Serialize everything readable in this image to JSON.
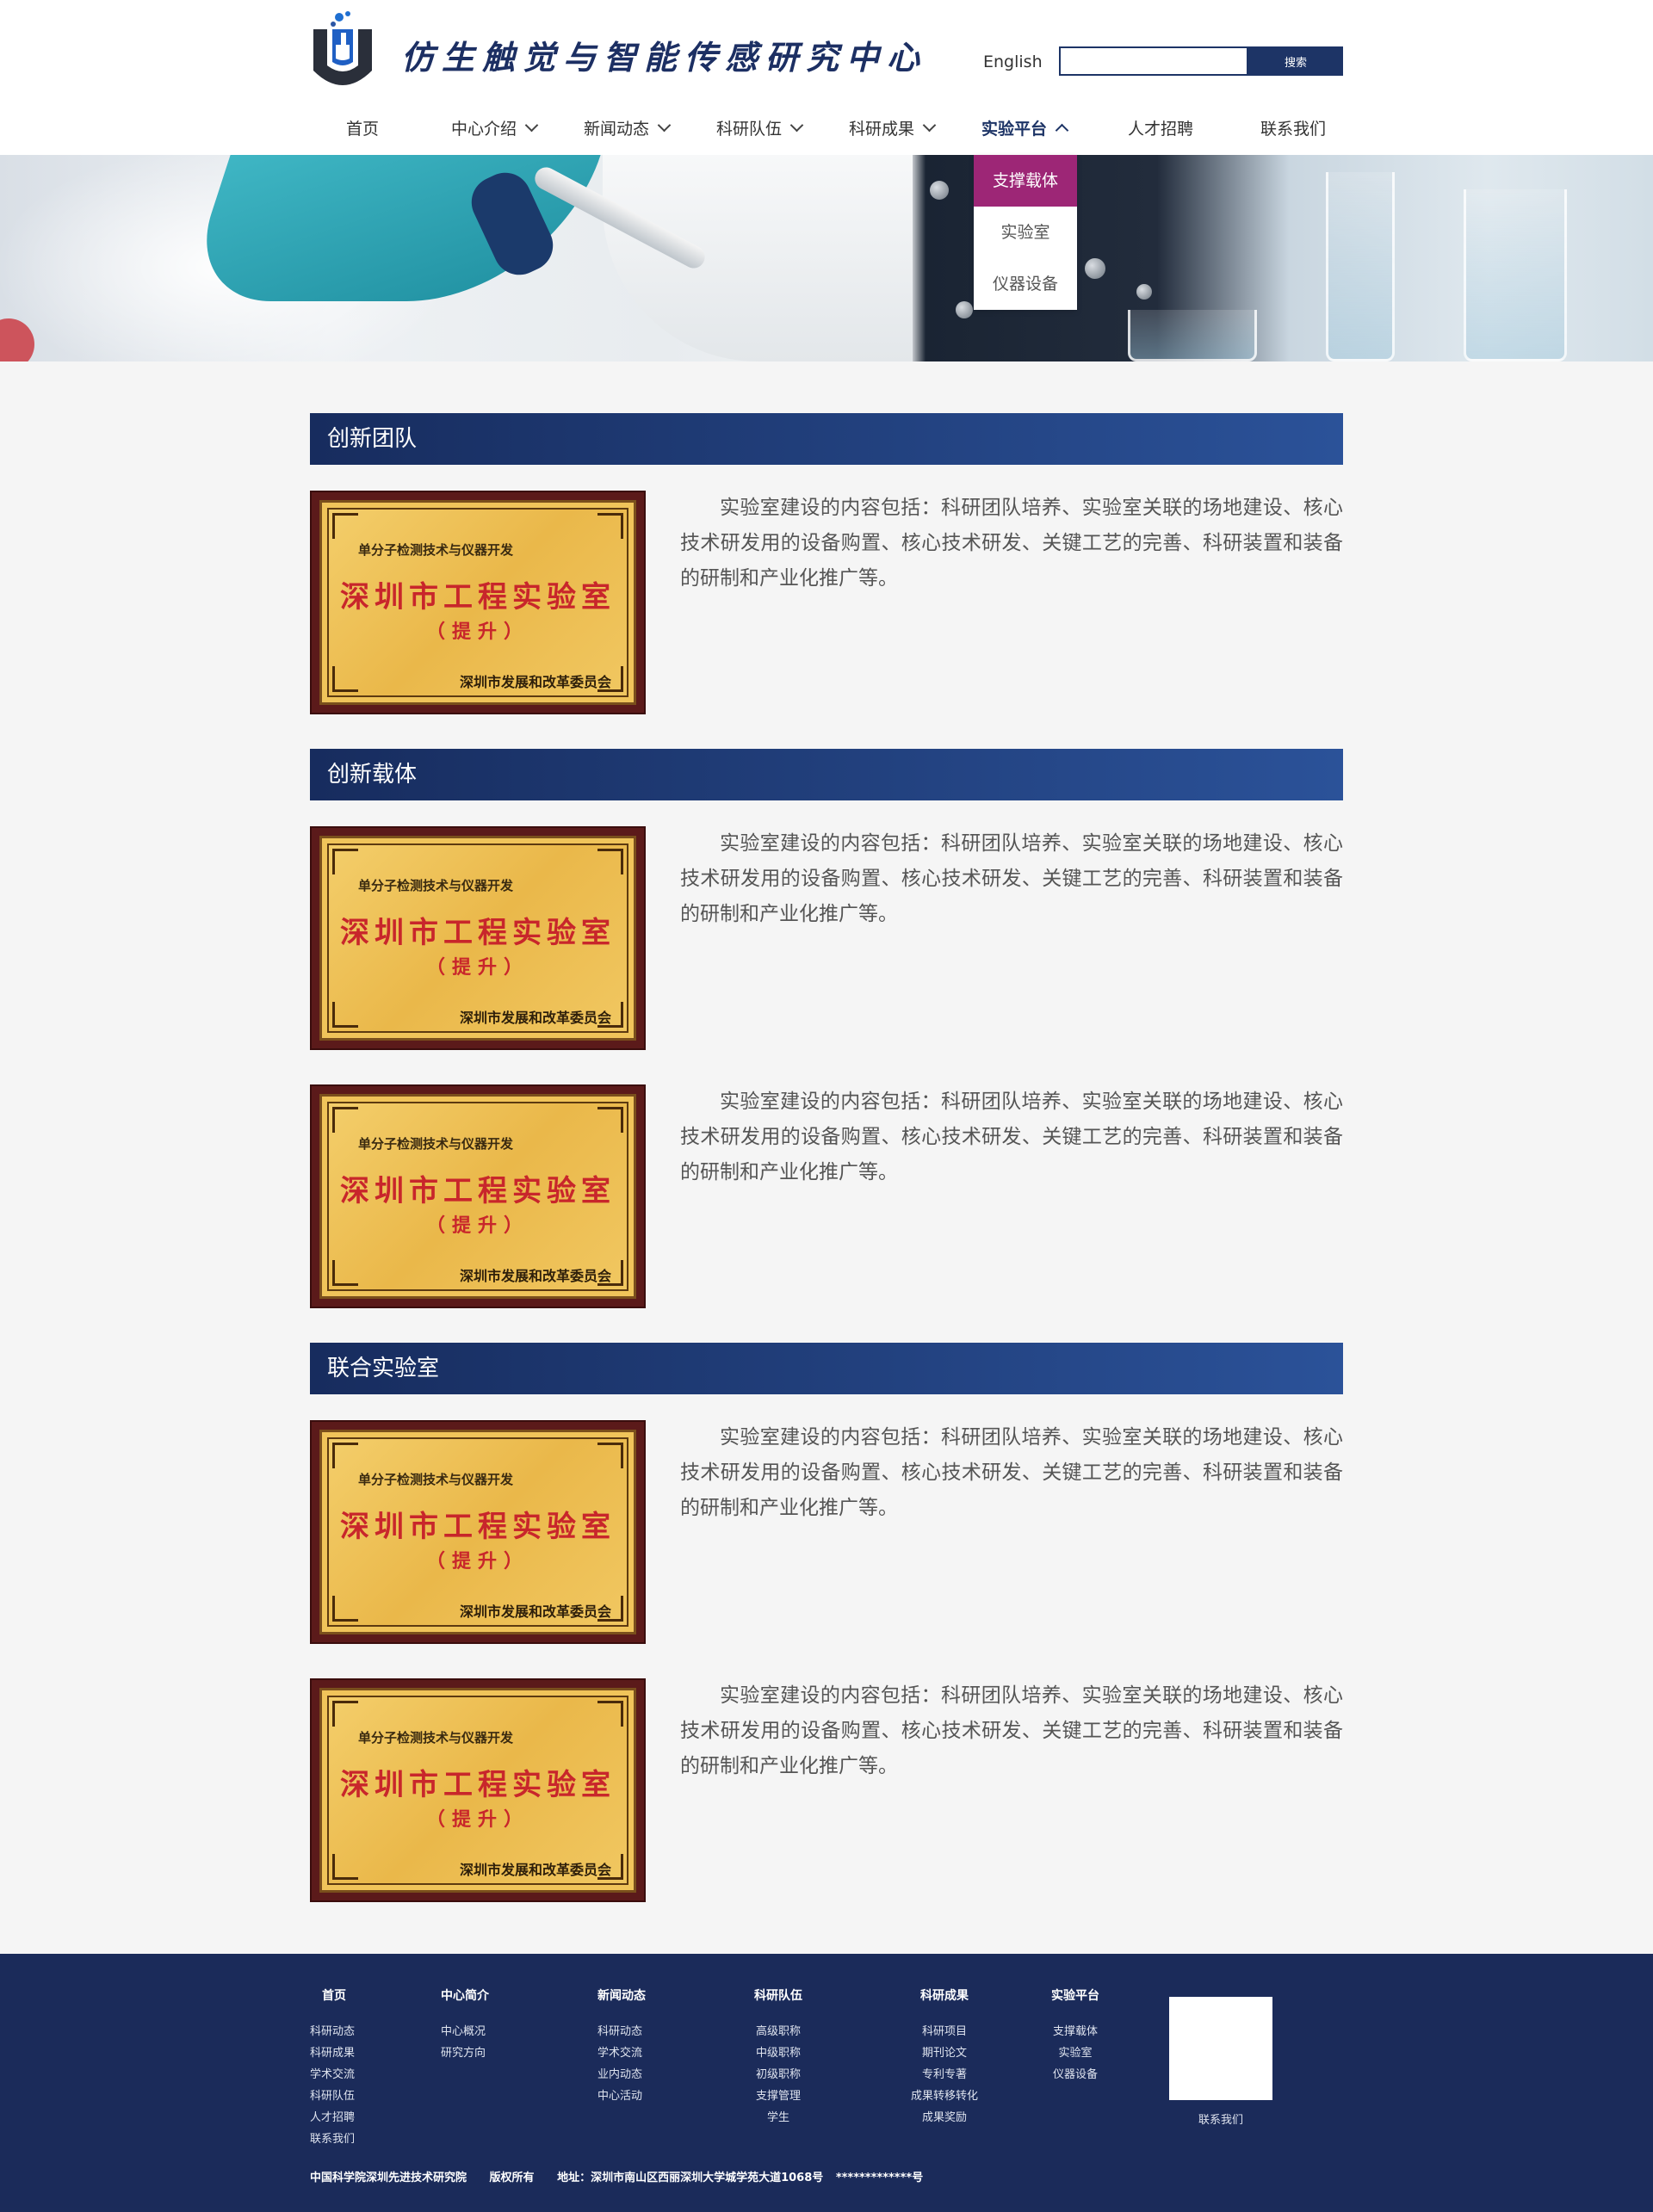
{
  "header": {
    "site_title": "仿生触觉与智能传感研究中心",
    "lang_link": "English",
    "search_placeholder": "",
    "search_button": "搜索"
  },
  "nav": {
    "items": [
      {
        "label": "首页",
        "has_dropdown": false
      },
      {
        "label": "中心介绍",
        "has_dropdown": true
      },
      {
        "label": "新闻动态",
        "has_dropdown": true
      },
      {
        "label": "科研队伍",
        "has_dropdown": true
      },
      {
        "label": "科研成果",
        "has_dropdown": true
      },
      {
        "label": "实验平台",
        "has_dropdown": true,
        "active": true
      },
      {
        "label": "人才招聘",
        "has_dropdown": false
      },
      {
        "label": "联系我们",
        "has_dropdown": false
      }
    ],
    "dropdown": [
      "支撑载体",
      "实验室",
      "仪器设备"
    ]
  },
  "plaque": {
    "top_text": "单分子检测技术与仪器开发",
    "main_text": "深圳市工程实验室",
    "sub_text": "（提升）",
    "bottom_text": "深圳市发展和改革委员会"
  },
  "sections": [
    {
      "title": "创新团队",
      "entries": [
        "实验室建设的内容包括：科研团队培养、实验室关联的场地建设、核心技术研发用的设备购置、核心技术研发、关键工艺的完善、科研装置和装备的研制和产业化推广等。"
      ]
    },
    {
      "title": "创新载体",
      "entries": [
        "实验室建设的内容包括：科研团队培养、实验室关联的场地建设、核心技术研发用的设备购置、核心技术研发、关键工艺的完善、科研装置和装备的研制和产业化推广等。",
        "实验室建设的内容包括：科研团队培养、实验室关联的场地建设、核心技术研发用的设备购置、核心技术研发、关键工艺的完善、科研装置和装备的研制和产业化推广等。"
      ]
    },
    {
      "title": "联合实验室",
      "entries": [
        "实验室建设的内容包括：科研团队培养、实验室关联的场地建设、核心技术研发用的设备购置、核心技术研发、关键工艺的完善、科研装置和装备的研制和产业化推广等。",
        "实验室建设的内容包括：科研团队培养、实验室关联的场地建设、核心技术研发用的设备购置、核心技术研发、关键工艺的完善、科研装置和装备的研制和产业化推广等。"
      ]
    }
  ],
  "footer": {
    "columns": [
      {
        "title": "首页",
        "links": [
          "科研动态",
          "科研成果",
          "学术交流",
          "科研队伍",
          "人才招聘",
          "联系我们"
        ]
      },
      {
        "title": "中心简介",
        "links": [
          "中心概况",
          "研究方向"
        ]
      },
      {
        "title": "新闻动态",
        "links": [
          "科研动态",
          "学术交流",
          "业内动态",
          "中心活动"
        ]
      },
      {
        "title": "科研队伍",
        "links": [
          "高级职称",
          "中级职称",
          "初级职称",
          "支撑管理",
          "学生"
        ]
      },
      {
        "title": "科研成果",
        "links": [
          "科研项目",
          "期刊论文",
          "专利专著",
          "成果转移转化",
          "成果奖励"
        ]
      },
      {
        "title": "实验平台",
        "links": [
          "支撑载体",
          "实验室",
          "仪器设备"
        ]
      }
    ],
    "qr_label": "联系我们",
    "copyright": {
      "org": "中国科学院深圳先进技术研究院",
      "rights": "版权所有",
      "address": "地址：深圳市南山区西丽深圳大学城学苑大道1068号",
      "icp": "*************号"
    }
  },
  "colors": {
    "brand_navy": "#1d3466",
    "dropdown_active": "#9d2676",
    "footer_bg": "#1b2b5a",
    "plaque_red": "#c8262b"
  }
}
